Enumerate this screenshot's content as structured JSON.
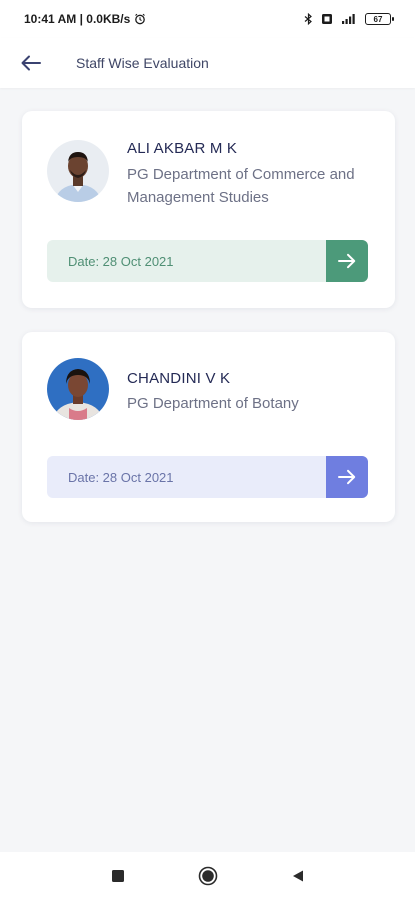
{
  "status_bar": {
    "time_speed": "10:41 AM | 0.0KB/s",
    "battery": "67",
    "icons": [
      "alarm-icon",
      "bluetooth-icon",
      "sim-icon",
      "signal-icon",
      "battery-icon"
    ]
  },
  "app_bar": {
    "title": "Staff Wise Evaluation",
    "back_icon": "arrow-left-icon"
  },
  "staff": [
    {
      "name": "ALI AKBAR M K",
      "department": "PG Department of Commerce and Management Studies",
      "date": "Date: 28 Oct 2021",
      "accent": "#4c9a7a",
      "date_bg": "#e6f1ec"
    },
    {
      "name": "CHANDINI V K",
      "department": "PG Department of Botany",
      "date": "Date: 28 Oct 2021",
      "accent": "#6f7ee0",
      "date_bg": "#e9ecfa"
    }
  ],
  "nav": {
    "icons": [
      "recents-square-icon",
      "home-circle-icon",
      "back-triangle-icon"
    ]
  }
}
